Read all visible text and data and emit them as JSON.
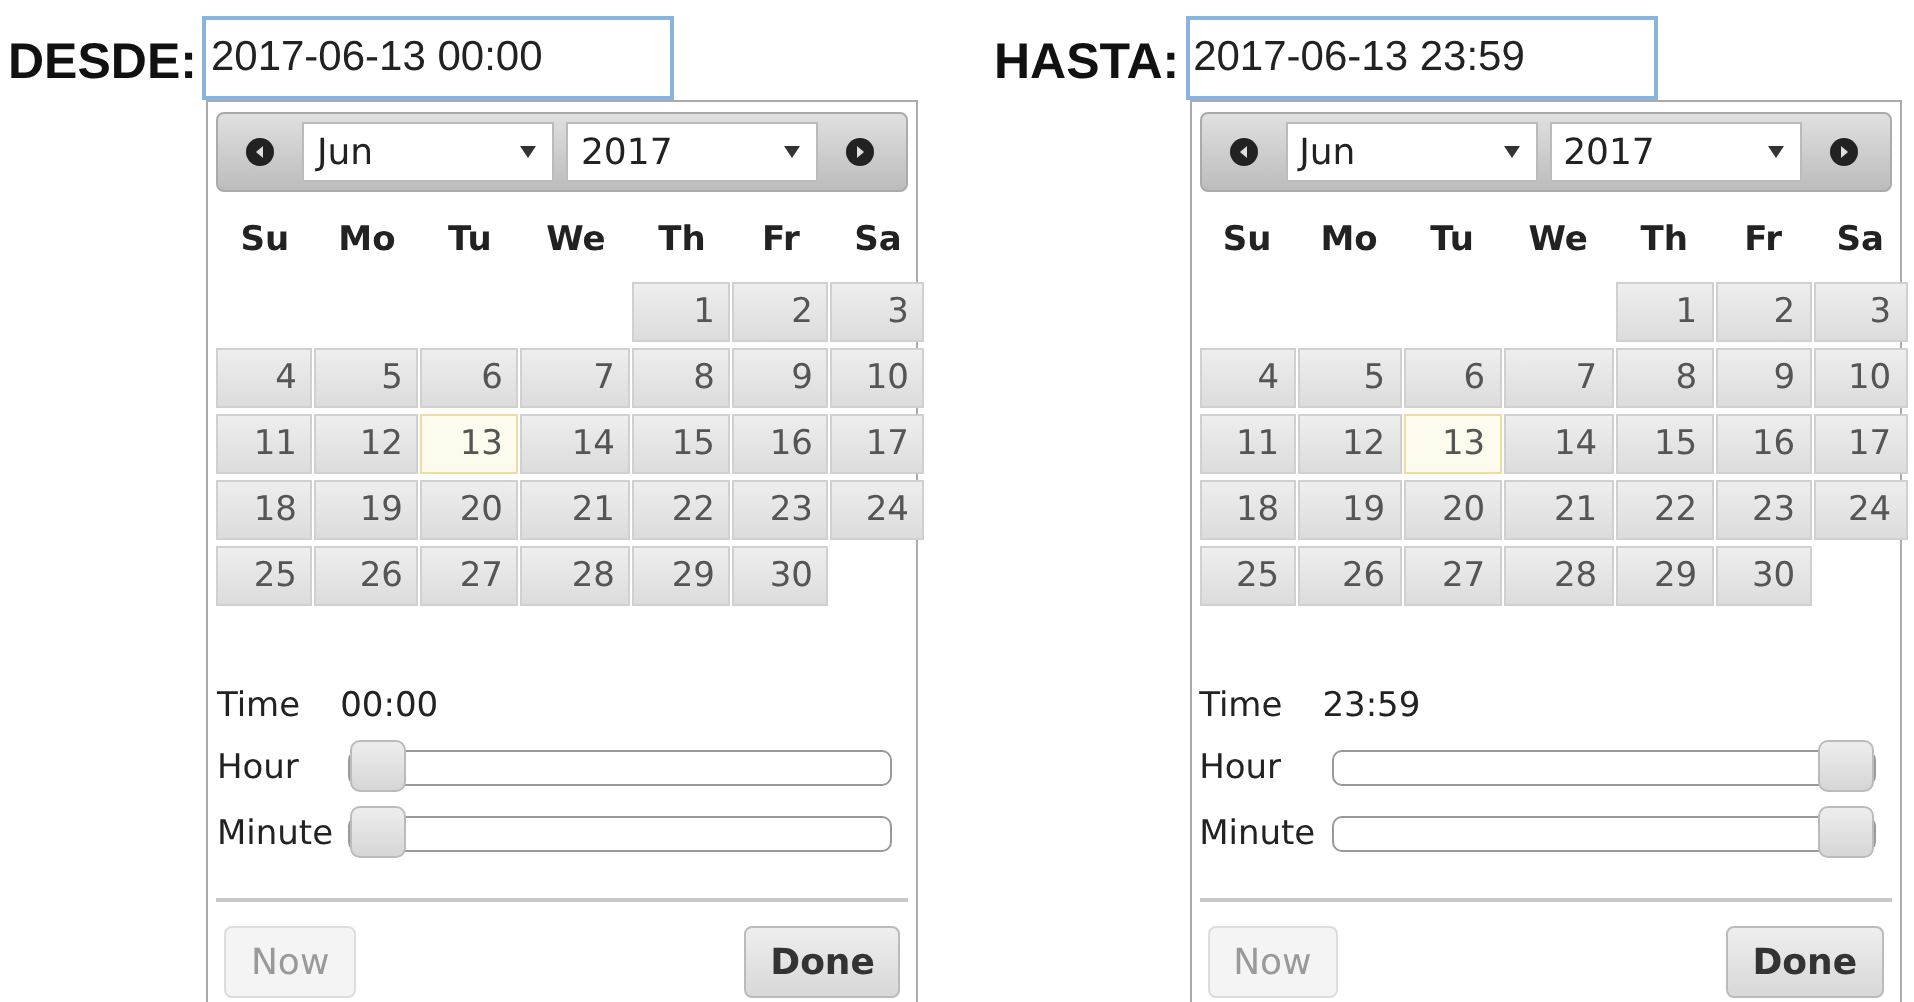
{
  "pickers": [
    {
      "label": "DESDE:",
      "value": "2017-06-13 00:00",
      "month": "Jun",
      "year": "2017",
      "weekdays": [
        "Su",
        "Mo",
        "Tu",
        "We",
        "Th",
        "Fr",
        "Sa"
      ],
      "weeks": [
        [
          {
            "kind": "empty"
          },
          {
            "kind": "empty"
          },
          {
            "kind": "empty"
          },
          {
            "kind": "empty"
          },
          {
            "kind": "day",
            "label": "1",
            "today": false
          },
          {
            "kind": "day",
            "label": "2",
            "today": false
          },
          {
            "kind": "day",
            "label": "3",
            "today": false
          }
        ],
        [
          {
            "kind": "day",
            "label": "4",
            "today": false
          },
          {
            "kind": "day",
            "label": "5",
            "today": false
          },
          {
            "kind": "day",
            "label": "6",
            "today": false
          },
          {
            "kind": "day",
            "label": "7",
            "today": false
          },
          {
            "kind": "day",
            "label": "8",
            "today": false
          },
          {
            "kind": "day",
            "label": "9",
            "today": false
          },
          {
            "kind": "day",
            "label": "10",
            "today": false
          }
        ],
        [
          {
            "kind": "day",
            "label": "11",
            "today": false
          },
          {
            "kind": "day",
            "label": "12",
            "today": false
          },
          {
            "kind": "day",
            "label": "13",
            "today": true
          },
          {
            "kind": "day",
            "label": "14",
            "today": false
          },
          {
            "kind": "day",
            "label": "15",
            "today": false
          },
          {
            "kind": "day",
            "label": "16",
            "today": false
          },
          {
            "kind": "day",
            "label": "17",
            "today": false
          }
        ],
        [
          {
            "kind": "day",
            "label": "18",
            "today": false
          },
          {
            "kind": "day",
            "label": "19",
            "today": false
          },
          {
            "kind": "day",
            "label": "20",
            "today": false
          },
          {
            "kind": "day",
            "label": "21",
            "today": false
          },
          {
            "kind": "day",
            "label": "22",
            "today": false
          },
          {
            "kind": "day",
            "label": "23",
            "today": false
          },
          {
            "kind": "day",
            "label": "24",
            "today": false
          }
        ],
        [
          {
            "kind": "day",
            "label": "25",
            "today": false
          },
          {
            "kind": "day",
            "label": "26",
            "today": false
          },
          {
            "kind": "day",
            "label": "27",
            "today": false
          },
          {
            "kind": "day",
            "label": "28",
            "today": false
          },
          {
            "kind": "day",
            "label": "29",
            "today": false
          },
          {
            "kind": "day",
            "label": "30",
            "today": false
          },
          {
            "kind": "empty"
          }
        ]
      ],
      "time_label": "Time",
      "time": "00:00",
      "sliders": [
        {
          "label": "Hour",
          "level": 0
        },
        {
          "label": "Minute",
          "level": 0
        }
      ],
      "buttons": [
        {
          "label": "Now",
          "disabled": true
        },
        {
          "label": "Done",
          "disabled": false
        }
      ]
    },
    {
      "label": "HASTA:",
      "value": "2017-06-13 23:59",
      "month": "Jun",
      "year": "2017",
      "weekdays": [
        "Su",
        "Mo",
        "Tu",
        "We",
        "Th",
        "Fr",
        "Sa"
      ],
      "weeks": [
        [
          {
            "kind": "empty"
          },
          {
            "kind": "empty"
          },
          {
            "kind": "empty"
          },
          {
            "kind": "empty"
          },
          {
            "kind": "day",
            "label": "1",
            "today": false
          },
          {
            "kind": "day",
            "label": "2",
            "today": false
          },
          {
            "kind": "day",
            "label": "3",
            "today": false
          }
        ],
        [
          {
            "kind": "day",
            "label": "4",
            "today": false
          },
          {
            "kind": "day",
            "label": "5",
            "today": false
          },
          {
            "kind": "day",
            "label": "6",
            "today": false
          },
          {
            "kind": "day",
            "label": "7",
            "today": false
          },
          {
            "kind": "day",
            "label": "8",
            "today": false
          },
          {
            "kind": "day",
            "label": "9",
            "today": false
          },
          {
            "kind": "day",
            "label": "10",
            "today": false
          }
        ],
        [
          {
            "kind": "day",
            "label": "11",
            "today": false
          },
          {
            "kind": "day",
            "label": "12",
            "today": false
          },
          {
            "kind": "day",
            "label": "13",
            "today": true
          },
          {
            "kind": "day",
            "label": "14",
            "today": false
          },
          {
            "kind": "day",
            "label": "15",
            "today": false
          },
          {
            "kind": "day",
            "label": "16",
            "today": false
          },
          {
            "kind": "day",
            "label": "17",
            "today": false
          }
        ],
        [
          {
            "kind": "day",
            "label": "18",
            "today": false
          },
          {
            "kind": "day",
            "label": "19",
            "today": false
          },
          {
            "kind": "day",
            "label": "20",
            "today": false
          },
          {
            "kind": "day",
            "label": "21",
            "today": false
          },
          {
            "kind": "day",
            "label": "22",
            "today": false
          },
          {
            "kind": "day",
            "label": "23",
            "today": false
          },
          {
            "kind": "day",
            "label": "24",
            "today": false
          }
        ],
        [
          {
            "kind": "day",
            "label": "25",
            "today": false
          },
          {
            "kind": "day",
            "label": "26",
            "today": false
          },
          {
            "kind": "day",
            "label": "27",
            "today": false
          },
          {
            "kind": "day",
            "label": "28",
            "today": false
          },
          {
            "kind": "day",
            "label": "29",
            "today": false
          },
          {
            "kind": "day",
            "label": "30",
            "today": false
          },
          {
            "kind": "empty"
          }
        ]
      ],
      "time_label": "Time",
      "time": "23:59",
      "sliders": [
        {
          "label": "Hour",
          "level": 1
        },
        {
          "label": "Minute",
          "level": 1
        }
      ],
      "buttons": [
        {
          "label": "Now",
          "disabled": true
        },
        {
          "label": "Done",
          "disabled": false
        }
      ]
    }
  ]
}
